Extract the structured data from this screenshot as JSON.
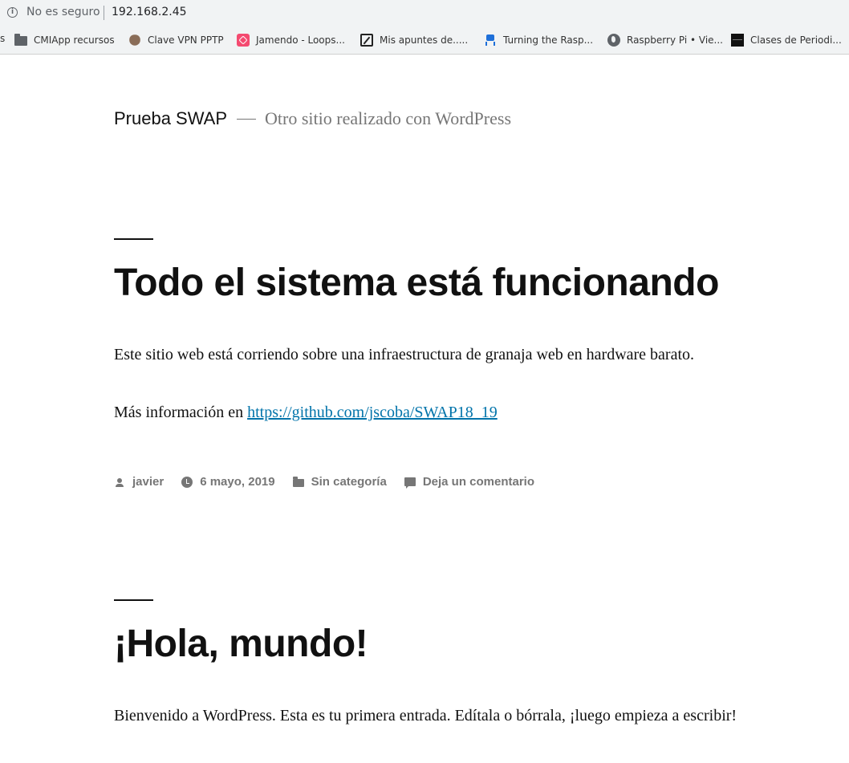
{
  "browser": {
    "security_label": "No es seguro",
    "url": "192.168.2.45"
  },
  "bookmarks": {
    "edge_label": "s",
    "items": [
      {
        "label": "CMIApp recursos",
        "icon": "folder-icon"
      },
      {
        "label": "Clave VPN PPTP",
        "icon": "university-crest-icon"
      },
      {
        "label": "Jamendo - Loops...",
        "icon": "jamendo-icon"
      },
      {
        "label": "Mis apuntes de.....",
        "icon": "edit-note-icon"
      },
      {
        "label": "Turning the Rasp...",
        "icon": "robot-icon"
      },
      {
        "label": "Raspberry Pi • Vie...",
        "icon": "globe-icon"
      },
      {
        "label": "Clases de Periodi...",
        "icon": "site-favicon-dark"
      }
    ]
  },
  "site": {
    "title": "Prueba SWAP",
    "description": "Otro sitio realizado con WordPress"
  },
  "posts": [
    {
      "title": "Todo el sistema está funcionando",
      "paragraph1": "Este sitio web está corriendo sobre una infraestructura de granaja web en hardware barato.",
      "paragraph2_prefix": "Más información en ",
      "link_text": "https://github.com/jscoba/SWAP18_19",
      "meta": {
        "author": "javier",
        "date": "6 mayo, 2019",
        "category": "Sin categoría",
        "comments": "Deja un comentario"
      }
    },
    {
      "title": "¡Hola, mundo!",
      "paragraph1": "Bienvenido a WordPress. Esta es tu primera entrada. Edítala o bórrala, ¡luego empieza a escribir!"
    }
  ],
  "colors": {
    "link": "#0073aa",
    "meta": "#767676",
    "text": "#111111",
    "chrome": "#f1f3f4"
  }
}
